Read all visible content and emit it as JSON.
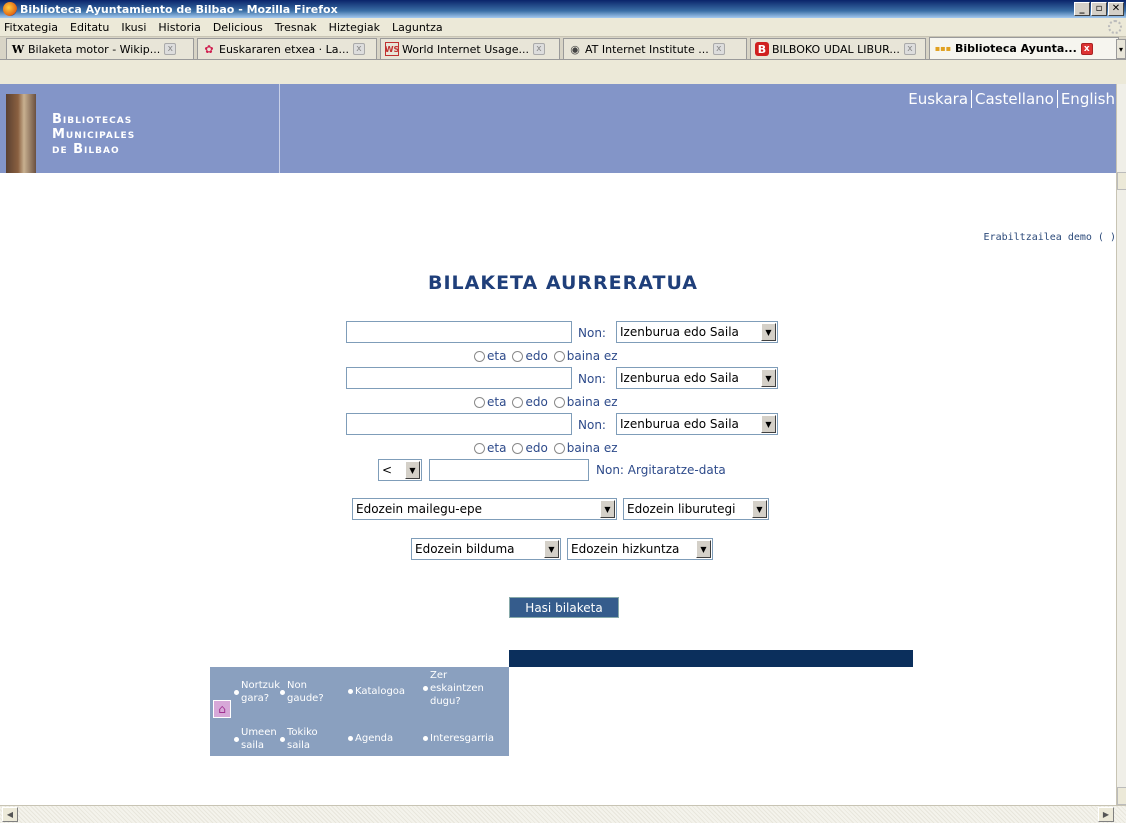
{
  "window": {
    "title": "Biblioteca Ayuntamiento de Bilbao - Mozilla Firefox",
    "buttons": [
      "_",
      "&#x25A1;",
      "x"
    ]
  },
  "menu": [
    "Fitxategia",
    "Editatu",
    "Ikusi",
    "Historia",
    "Delicious",
    "Tresnak",
    "Hiztegiak",
    "Laguntza"
  ],
  "tabs": [
    {
      "label": "Bilaketa motor - Wikip...",
      "icon": "W"
    },
    {
      "label": "Euskararen etxea · La...",
      "icon": "✿"
    },
    {
      "label": "World Internet Usage...",
      "icon": "WS"
    },
    {
      "label": "AT Internet Institute ...",
      "icon": "◉"
    },
    {
      "label": "BILBOKO UDAL LIBUR...",
      "icon": "B"
    },
    {
      "label": "Biblioteca Ayunta...",
      "icon": "▪▪▪"
    }
  ],
  "header": {
    "logo_lines": [
      "Bibliotecas",
      "Municipales",
      "de Bilbao"
    ],
    "languages": [
      "Euskara",
      "Castellano",
      "English"
    ]
  },
  "user_line": "Erabiltzailea demo ( )",
  "page_title": "BILAKETA AURRERATUA",
  "form": {
    "non_label": "Non:",
    "field_select": "Izenburua edo Saila",
    "radios": [
      "eta",
      "edo",
      "baina ez"
    ],
    "date_op": "<",
    "date_label": "Non: Argitaratze-data",
    "loan_select": "Edozein mailegu-epe",
    "library_select": "Edozein liburutegi",
    "collection_select": "Edozein bilduma",
    "language_select": "Edozein hizkuntza",
    "search_button": "Hasi bilaketa"
  },
  "footer_nav": {
    "row1": [
      [
        "Nortzuk",
        "gara?"
      ],
      [
        "Non",
        "gaude?"
      ],
      [
        "Katalogoa"
      ],
      [
        "Zer",
        "eskaintzen",
        "dugu?"
      ]
    ],
    "row2": [
      [
        "Umeen",
        "saila"
      ],
      [
        "Tokiko",
        "saila"
      ],
      [
        "Agenda"
      ],
      [
        "Interesgarria"
      ]
    ]
  }
}
